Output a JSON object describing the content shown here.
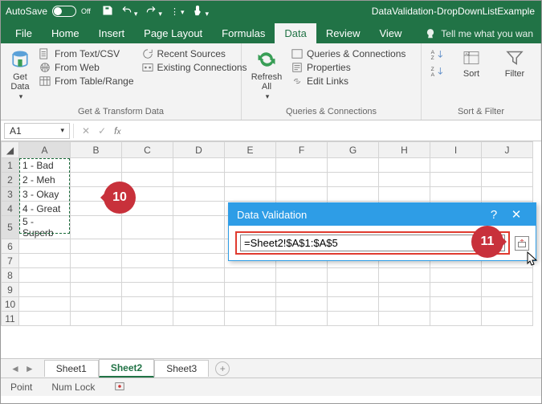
{
  "titlebar": {
    "autosave_label": "AutoSave",
    "autosave_state": "Off",
    "document_title": "DataValidation-DropDownListExample"
  },
  "tabs": {
    "file": "File",
    "home": "Home",
    "insert": "Insert",
    "pagelayout": "Page Layout",
    "formulas": "Formulas",
    "data": "Data",
    "review": "Review",
    "view": "View",
    "tellme": "Tell me what you wan"
  },
  "ribbon": {
    "getdata": {
      "btn": "Get Data",
      "a": "From Text/CSV",
      "b": "From Web",
      "c": "From Table/Range",
      "d": "Recent Sources",
      "e": "Existing Connections",
      "group": "Get & Transform Data"
    },
    "refresh": {
      "btn": "Refresh All",
      "a": "Queries & Connections",
      "b": "Properties",
      "c": "Edit Links",
      "group": "Queries & Connections"
    },
    "sortfilter": {
      "sort": "Sort",
      "filter": "Filter",
      "group": "Sort & Filter"
    }
  },
  "namebox": "A1",
  "columns": [
    "A",
    "B",
    "C",
    "D",
    "E",
    "F",
    "G",
    "H",
    "I",
    "J"
  ],
  "rows": [
    "1",
    "2",
    "3",
    "4",
    "5",
    "6",
    "7",
    "8",
    "9",
    "10",
    "11"
  ],
  "cells": {
    "A1": "1 - Bad",
    "A2": "2 - Meh",
    "A3": "3 - Okay",
    "A4": "4 - Great",
    "A5": "5 - Superb"
  },
  "dialog": {
    "title": "Data Validation",
    "formula": "=Sheet2!$A$1:$A$5"
  },
  "badges": {
    "left": "10",
    "right": "11"
  },
  "sheets": {
    "s1": "Sheet1",
    "s2": "Sheet2",
    "s3": "Sheet3"
  },
  "status": {
    "mode": "Point",
    "numlock": "Num Lock"
  }
}
